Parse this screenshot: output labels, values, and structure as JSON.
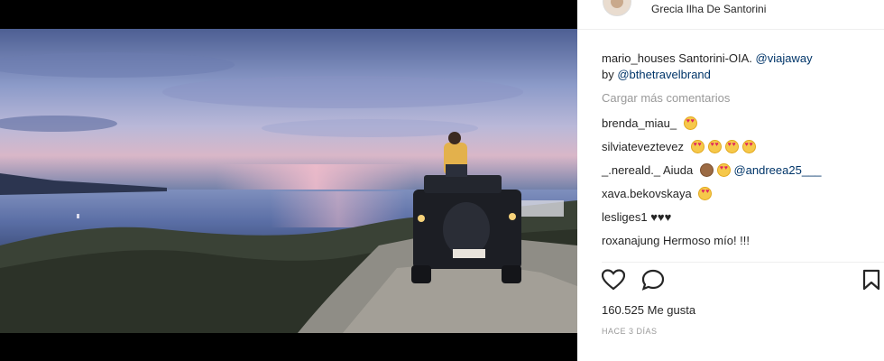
{
  "post": {
    "location": "Grecia Ilha De Santorini",
    "caption": {
      "username": "mario_houses",
      "text": " Santorini-OIA. ",
      "mention1": "@viajaway",
      "by": "by ",
      "mention2": "@bthetravelbrand"
    },
    "load_more": "Cargar más comentarios",
    "comments": [
      {
        "user": "brenda_miau_",
        "text": ""
      },
      {
        "user": "silviateveztevez",
        "text": ""
      },
      {
        "user": "_.nereald._",
        "text": " Aiuda",
        "mention": "@andreea25___"
      },
      {
        "user": "xava.bekovskaya",
        "text": ""
      },
      {
        "user": "lesliges1",
        "text": " ♥♥♥"
      },
      {
        "user": "roxanajung",
        "text": " Hermoso mío! !!!"
      }
    ],
    "likes_count": "160.525",
    "likes_label": " Me gusta",
    "time_ago": "HACE 3 DÍAS"
  },
  "icons": [
    "heart-icon",
    "comment-icon",
    "bookmark-icon"
  ],
  "colors": {
    "mention": "#003569",
    "muted": "#999999",
    "text": "#262626"
  }
}
